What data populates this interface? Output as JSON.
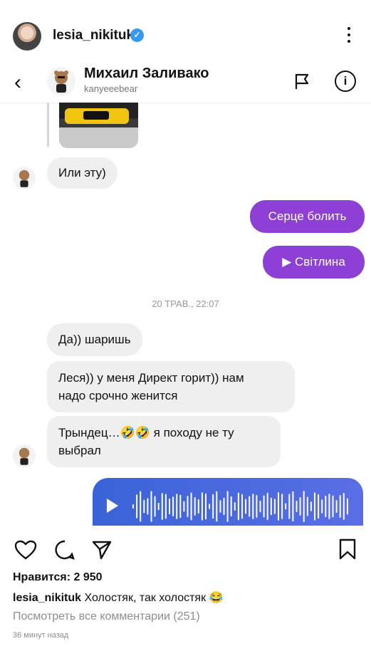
{
  "post": {
    "username": "lesia_nikituk",
    "verified_mark": "✓",
    "likes": "Нравится: 2 950",
    "caption_user": "lesia_nikituk",
    "caption_text": " Холостяк, так холостяк 😂",
    "view_comments": "Посмотреть все комментарии (251)",
    "time": "36 минут назад"
  },
  "dm": {
    "contact_name": "Михаил Заливако",
    "contact_handle": "kanyeeebear",
    "back_glyph": "‹",
    "info_glyph": "i",
    "timestamp": "20 ТРАВ., 22:07",
    "messages": [
      {
        "text": "Или эту)"
      },
      {
        "text": "Серце болить"
      },
      {
        "text": "▶ Світлина"
      },
      {
        "text": "Да)) шаришь"
      },
      {
        "line1": "Леся)) у меня Директ горит)) нам",
        "line2": "надо срочно женится"
      },
      {
        "line1": "Трындец…🤣🤣 я походу не ту",
        "line2": "выбрал"
      }
    ]
  },
  "colors": {
    "outgoing_bubble": "#8e3fd6",
    "voice_gradient_start": "#3a63d8",
    "voice_gradient_end": "#5a6ee6",
    "verified": "#3897f0"
  },
  "icons": [
    "kebab-menu-icon",
    "back-arrow-icon",
    "flag-icon",
    "info-icon",
    "play-icon",
    "heart-icon",
    "comment-icon",
    "send-icon",
    "bookmark-icon"
  ]
}
